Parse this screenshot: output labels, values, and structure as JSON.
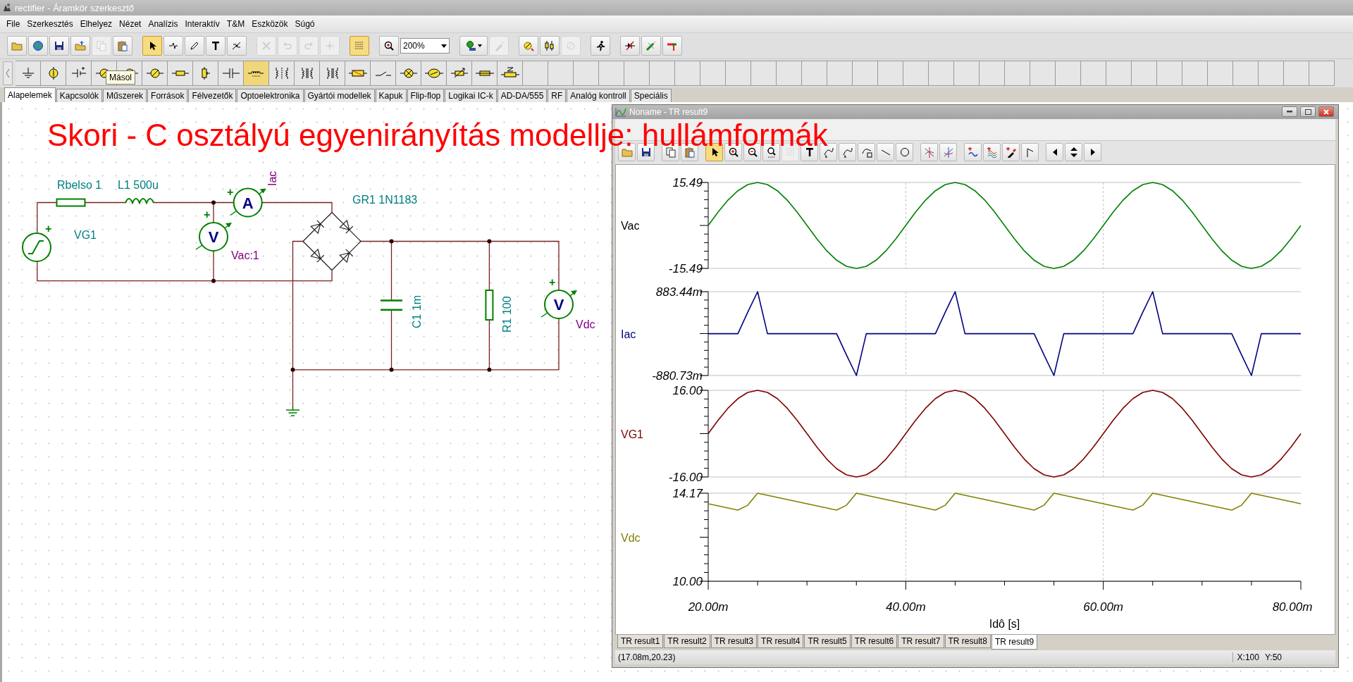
{
  "window": {
    "title": "rectifier - Áramkör szerkesztő"
  },
  "menu": [
    "File",
    "Szerkesztés",
    "Elhelyez",
    "Nézet",
    "Analízis",
    "Interaktív",
    "T&M",
    "Eszközök",
    "Súgó"
  ],
  "toolbar": [
    [
      {
        "kind": "folder",
        "active": false,
        "disabled": false
      },
      {
        "kind": "globe",
        "active": false,
        "disabled": false
      },
      {
        "kind": "floppy",
        "active": false,
        "disabled": false
      },
      {
        "kind": "folder-up",
        "active": false,
        "disabled": false
      },
      {
        "kind": "copy",
        "active": false,
        "disabled": true
      },
      {
        "kind": "paste",
        "active": false,
        "disabled": false
      }
    ],
    [
      {
        "kind": "pointer",
        "active": true,
        "disabled": false
      },
      {
        "kind": "wire",
        "active": false,
        "disabled": false
      },
      {
        "kind": "pencil",
        "active": false,
        "disabled": false
      },
      {
        "kind": "text",
        "active": false,
        "disabled": false
      },
      {
        "kind": "node",
        "active": false,
        "disabled": false
      }
    ],
    [
      {
        "kind": "delete",
        "active": false,
        "disabled": true
      },
      {
        "kind": "undo",
        "active": false,
        "disabled": true
      },
      {
        "kind": "redo",
        "active": false,
        "disabled": true
      },
      {
        "kind": "crosshair",
        "active": false,
        "disabled": true
      }
    ],
    [
      {
        "kind": "grid",
        "active": true,
        "disabled": false
      }
    ],
    [
      {
        "kind": "zoom",
        "active": false,
        "disabled": false
      },
      {
        "kind": "combo",
        "value": "200%"
      }
    ],
    [
      {
        "kind": "dc-menu",
        "active": false,
        "disabled": false
      },
      {
        "kind": "probe",
        "active": false,
        "disabled": true
      }
    ],
    [
      {
        "kind": "meter-v",
        "active": false,
        "disabled": false
      },
      {
        "kind": "meter-k",
        "active": false,
        "disabled": false
      },
      {
        "kind": "meter-off",
        "active": false,
        "disabled": true
      }
    ],
    [
      {
        "kind": "runner",
        "active": false,
        "disabled": false
      }
    ],
    [
      {
        "kind": "diode-red",
        "active": false,
        "disabled": false
      },
      {
        "kind": "probe-green",
        "active": false,
        "disabled": false
      },
      {
        "kind": "pin-red",
        "active": false,
        "disabled": false
      }
    ]
  ],
  "palette": [
    {
      "kind": "ground",
      "selected": false
    },
    {
      "kind": "source",
      "selected": false
    },
    {
      "kind": "battery",
      "selected": false
    },
    {
      "kind": "meter",
      "selected": false
    },
    {
      "kind": "meter",
      "selected": false
    },
    {
      "kind": "meter",
      "selected": false
    },
    {
      "kind": "resistor",
      "selected": false
    },
    {
      "kind": "potentiometer",
      "selected": false
    },
    {
      "kind": "capacitor",
      "selected": false
    },
    {
      "kind": "inductor",
      "selected": true
    },
    {
      "kind": "coupled-inductor",
      "selected": false
    },
    {
      "kind": "transformer",
      "selected": false
    },
    {
      "kind": "transformer",
      "selected": false
    },
    {
      "kind": "resistor-long",
      "selected": false
    },
    {
      "kind": "switch",
      "selected": false
    },
    {
      "kind": "lamp",
      "selected": false
    },
    {
      "kind": "oval",
      "selected": false
    },
    {
      "kind": "variable-resistor",
      "selected": false
    },
    {
      "kind": "fuse",
      "selected": false
    },
    {
      "kind": "impedance",
      "selected": false
    }
  ],
  "tooltip": {
    "text": "Másol"
  },
  "tabs": [
    {
      "label": "Alapelemek",
      "selected": true
    },
    {
      "label": "Kapcsolók",
      "selected": false
    },
    {
      "label": "Műszerek",
      "selected": false
    },
    {
      "label": "Források",
      "selected": false
    },
    {
      "label": "Félvezetők",
      "selected": false
    },
    {
      "label": "Optoelektronika",
      "selected": false
    },
    {
      "label": "Gyártói modellek",
      "selected": false
    },
    {
      "label": "Kapuk",
      "selected": false
    },
    {
      "label": "Flip-flop",
      "selected": false
    },
    {
      "label": "Logikai IC-k",
      "selected": false
    },
    {
      "label": "AD-DA/555",
      "selected": false
    },
    {
      "label": "RF",
      "selected": false
    },
    {
      "label": "Analóg kontroll",
      "selected": false
    },
    {
      "label": "Speciális",
      "selected": false
    }
  ],
  "canvas": {
    "title": "Skori - C osztályú egyenirányítás modellje: hullámformák",
    "circuit": {
      "parts": [
        {
          "kind": "source",
          "label": "VG1",
          "polarity": "+"
        },
        {
          "kind": "resistor",
          "label": "Rbelso 1"
        },
        {
          "kind": "inductor",
          "label": "L1 500u"
        },
        {
          "kind": "meter",
          "label": "Iac",
          "symbol": "A",
          "polarity": "+"
        },
        {
          "kind": "meter",
          "label": "Vac:1",
          "symbol": "V",
          "polarity": "+"
        },
        {
          "kind": "bridge",
          "label": "GR1 1N1183"
        },
        {
          "kind": "capacitor",
          "label": "C1 1m"
        },
        {
          "kind": "resistor",
          "label": "R1 100"
        },
        {
          "kind": "meter",
          "label": "Vdc",
          "symbol": "V",
          "polarity": "+"
        },
        {
          "kind": "ground"
        }
      ]
    }
  },
  "result_window": {
    "title": "Noname - TR result9",
    "toolbar": [
      [
        {
          "kind": "folder",
          "active": false,
          "disabled": false
        },
        {
          "kind": "floppy",
          "active": false,
          "disabled": false
        }
      ],
      [
        {
          "kind": "copy",
          "active": false,
          "disabled": false
        },
        {
          "kind": "paste",
          "active": false,
          "disabled": false
        }
      ],
      [
        {
          "kind": "pointer",
          "active": true,
          "disabled": false
        },
        {
          "kind": "zoom",
          "active": false,
          "disabled": false
        },
        {
          "kind": "zoom-out",
          "active": false,
          "disabled": false
        },
        {
          "kind": "zoom-fit",
          "active": false,
          "disabled": false
        },
        {
          "kind": "grid",
          "active": false,
          "disabled": true
        },
        {
          "kind": "text",
          "active": false,
          "disabled": false
        },
        {
          "kind": "curve",
          "active": false,
          "disabled": false
        },
        {
          "kind": "curve",
          "active": false,
          "disabled": false
        },
        {
          "kind": "curve-box",
          "active": false,
          "disabled": false
        },
        {
          "kind": "line",
          "active": false,
          "disabled": false
        },
        {
          "kind": "circle",
          "active": false,
          "disabled": false
        }
      ],
      [
        {
          "kind": "cursor-a",
          "active": false,
          "disabled": false
        },
        {
          "kind": "cursor-b",
          "active": false,
          "disabled": false
        }
      ],
      [
        {
          "kind": "add-curve",
          "active": false,
          "disabled": false
        },
        {
          "kind": "multi-curve",
          "active": false,
          "disabled": false
        },
        {
          "kind": "eyedropper",
          "active": false,
          "disabled": false
        },
        {
          "kind": "flag",
          "active": false,
          "disabled": false
        }
      ],
      [
        {
          "kind": "arrow-left",
          "active": false,
          "disabled": false
        },
        {
          "kind": "arrow-updown",
          "active": false,
          "disabled": false
        },
        {
          "kind": "arrow-right",
          "active": false,
          "disabled": false
        }
      ]
    ],
    "panels": [
      {
        "color": "#000000",
        "chart_data": {
          "type": "line",
          "x": [
            20,
            21,
            22,
            23,
            24,
            25,
            26,
            27,
            28,
            29,
            30,
            31,
            32,
            33,
            34,
            35,
            36,
            37,
            38,
            39,
            40,
            41,
            42,
            43,
            44,
            45,
            46,
            47,
            48,
            49,
            50,
            51,
            52,
            53,
            54,
            55,
            56,
            57,
            58,
            59,
            60,
            61,
            62,
            63,
            64,
            65,
            66,
            67,
            68,
            69,
            70,
            71,
            72,
            73,
            74,
            75,
            76,
            77,
            78,
            79,
            80
          ],
          "xlim": [
            20,
            80
          ],
          "ylim": [
            -15.49,
            15.49
          ],
          "yticks": [
            {
              "value": -15.49,
              "label": "-15.49"
            },
            {
              "value": 15.49,
              "label": "15.49"
            }
          ],
          "series": [
            {
              "name": "Vac",
              "color": "#008000",
              "values": [
                0,
                4.79,
                9.11,
                12.53,
                14.73,
                15.49,
                14.73,
                12.53,
                9.11,
                4.79,
                0,
                -4.79,
                -9.11,
                -12.53,
                -14.73,
                -15.49,
                -14.73,
                -12.53,
                -9.11,
                -4.79,
                0,
                4.79,
                9.11,
                12.53,
                14.73,
                15.49,
                14.73,
                12.53,
                9.11,
                4.79,
                0,
                -4.79,
                -9.11,
                -12.53,
                -14.73,
                -15.49,
                -14.73,
                -12.53,
                -9.11,
                -4.79,
                0,
                4.79,
                9.11,
                12.53,
                14.73,
                15.49,
                14.73,
                12.53,
                9.11,
                4.79,
                0,
                -4.79,
                -9.11,
                -12.53,
                -14.73,
                -15.49,
                -14.73,
                -12.53,
                -9.11,
                -4.79,
                0
              ]
            }
          ]
        }
      },
      {
        "color": "#000080",
        "chart_data": {
          "type": "line",
          "x": [
            20,
            21,
            22,
            23,
            24,
            25,
            26,
            27,
            28,
            29,
            30,
            31,
            32,
            33,
            34,
            35,
            36,
            37,
            38,
            39,
            40,
            41,
            42,
            43,
            44,
            45,
            46,
            47,
            48,
            49,
            50,
            51,
            52,
            53,
            54,
            55,
            56,
            57,
            58,
            59,
            60,
            61,
            62,
            63,
            64,
            65,
            66,
            67,
            68,
            69,
            70,
            71,
            72,
            73,
            74,
            75,
            76,
            77,
            78,
            79,
            80
          ],
          "xlim": [
            20,
            80
          ],
          "ylim": [
            -880.73,
            883.44
          ],
          "yticks": [
            {
              "value": -880.73,
              "label": "-880.73m"
            },
            {
              "value": 883.44,
              "label": "883.44m"
            }
          ],
          "series": [
            {
              "name": "Iac",
              "color": "#000080",
              "values": [
                0,
                0,
                0,
                0,
                450,
                883.44,
                0,
                0,
                0,
                0,
                0,
                0,
                0,
                0,
                -450,
                -880.73,
                0,
                0,
                0,
                0,
                0,
                0,
                0,
                0,
                450,
                883.44,
                0,
                0,
                0,
                0,
                0,
                0,
                0,
                0,
                -450,
                -880.73,
                0,
                0,
                0,
                0,
                0,
                0,
                0,
                0,
                450,
                883.44,
                0,
                0,
                0,
                0,
                0,
                0,
                0,
                0,
                -450,
                -880.73,
                0,
                0,
                0,
                0,
                0
              ]
            }
          ]
        }
      },
      {
        "color": "#800000",
        "chart_data": {
          "type": "line",
          "x": [
            20,
            21,
            22,
            23,
            24,
            25,
            26,
            27,
            28,
            29,
            30,
            31,
            32,
            33,
            34,
            35,
            36,
            37,
            38,
            39,
            40,
            41,
            42,
            43,
            44,
            45,
            46,
            47,
            48,
            49,
            50,
            51,
            52,
            53,
            54,
            55,
            56,
            57,
            58,
            59,
            60,
            61,
            62,
            63,
            64,
            65,
            66,
            67,
            68,
            69,
            70,
            71,
            72,
            73,
            74,
            75,
            76,
            77,
            78,
            79,
            80
          ],
          "xlim": [
            20,
            80
          ],
          "ylim": [
            -16,
            16
          ],
          "yticks": [
            {
              "value": -16,
              "label": "-16.00"
            },
            {
              "value": 16,
              "label": "16.00"
            }
          ],
          "series": [
            {
              "name": "VG1",
              "color": "#800000",
              "values": [
                0,
                4.94,
                9.4,
                12.94,
                15.22,
                16,
                15.22,
                12.94,
                9.4,
                4.94,
                0,
                -4.94,
                -9.4,
                -12.94,
                -15.22,
                -16,
                -15.22,
                -12.94,
                -9.4,
                -4.94,
                0,
                4.94,
                9.4,
                12.94,
                15.22,
                16,
                15.22,
                12.94,
                9.4,
                4.94,
                0,
                -4.94,
                -9.4,
                -12.94,
                -15.22,
                -16,
                -15.22,
                -12.94,
                -9.4,
                -4.94,
                0,
                4.94,
                9.4,
                12.94,
                15.22,
                16,
                15.22,
                12.94,
                9.4,
                4.94,
                0,
                -4.94,
                -9.4,
                -12.94,
                -15.22,
                -16,
                -15.22,
                -12.94,
                -9.4,
                -4.94,
                0
              ]
            }
          ]
        }
      },
      {
        "color": "#808000",
        "chart_data": {
          "type": "line",
          "xlabel": "Idô [s]",
          "x": [
            20,
            21,
            22,
            23,
            24,
            25,
            26,
            27,
            28,
            29,
            30,
            31,
            32,
            33,
            34,
            35,
            36,
            37,
            38,
            39,
            40,
            41,
            42,
            43,
            44,
            45,
            46,
            47,
            48,
            49,
            50,
            51,
            52,
            53,
            54,
            55,
            56,
            57,
            58,
            59,
            60,
            61,
            62,
            63,
            64,
            65,
            66,
            67,
            68,
            69,
            70,
            71,
            72,
            73,
            74,
            75,
            76,
            77,
            78,
            79,
            80
          ],
          "xlim": [
            20,
            80
          ],
          "ylim": [
            10,
            14.17
          ],
          "xticks": [
            {
              "value": 20,
              "label": "20.00m"
            },
            {
              "value": 40,
              "label": "40.00m"
            },
            {
              "value": 60,
              "label": "60.00m"
            },
            {
              "value": 80,
              "label": "80.00m"
            }
          ],
          "yticks": [
            {
              "value": 10,
              "label": "10.00"
            },
            {
              "value": 14.17,
              "label": "14.17"
            }
          ],
          "series": [
            {
              "name": "Vdc",
              "color": "#808000",
              "values": [
                13.67,
                13.57,
                13.47,
                13.37,
                13.6,
                14.17,
                14.07,
                13.97,
                13.87,
                13.77,
                13.67,
                13.57,
                13.47,
                13.37,
                13.6,
                14.17,
                14.07,
                13.97,
                13.87,
                13.77,
                13.67,
                13.57,
                13.47,
                13.37,
                13.6,
                14.17,
                14.07,
                13.97,
                13.87,
                13.77,
                13.67,
                13.57,
                13.47,
                13.37,
                13.6,
                14.17,
                14.07,
                13.97,
                13.87,
                13.77,
                13.67,
                13.57,
                13.47,
                13.37,
                13.6,
                14.17,
                14.07,
                13.97,
                13.87,
                13.77,
                13.67,
                13.57,
                13.47,
                13.37,
                13.6,
                14.17,
                14.07,
                13.97,
                13.87,
                13.77,
                13.67
              ]
            }
          ]
        }
      }
    ],
    "tabs": [
      {
        "label": "TR result1",
        "selected": false
      },
      {
        "label": "TR result2",
        "selected": false
      },
      {
        "label": "TR result3",
        "selected": false
      },
      {
        "label": "TR result4",
        "selected": false
      },
      {
        "label": "TR result5",
        "selected": false
      },
      {
        "label": "TR result6",
        "selected": false
      },
      {
        "label": "TR result7",
        "selected": false
      },
      {
        "label": "TR result8",
        "selected": false
      },
      {
        "label": "TR result9",
        "selected": true
      }
    ],
    "status": {
      "coords": "(17.08m,20.23)",
      "x": "X:100",
      "y": "Y:50"
    }
  }
}
